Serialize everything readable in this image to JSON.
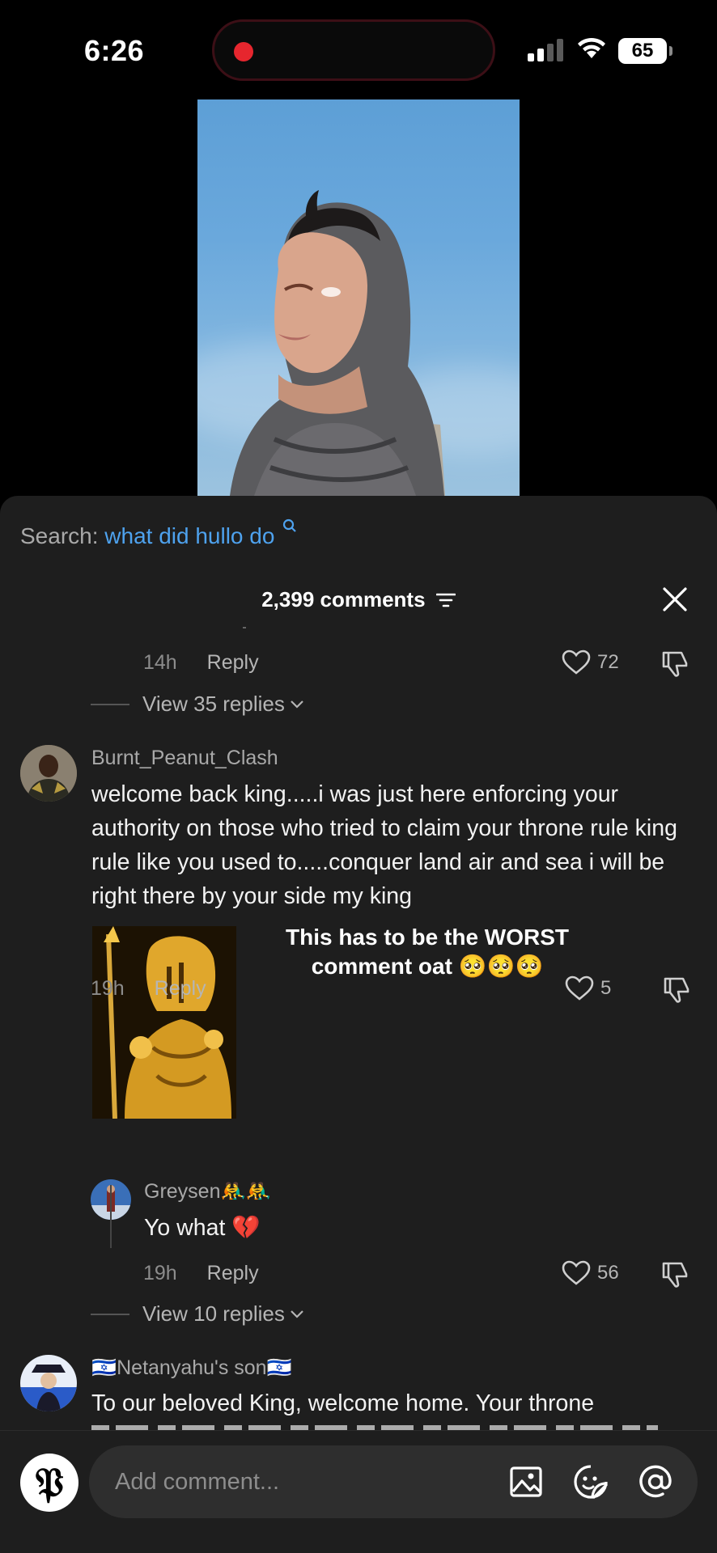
{
  "status_bar": {
    "time": "6:26",
    "battery": "65"
  },
  "search": {
    "prefix": "Search:",
    "query": "what did hullo do"
  },
  "sheet": {
    "comment_count": "2,399 comments"
  },
  "comments": [
    {
      "time": "14h",
      "reply_label": "Reply",
      "likes": "72",
      "view_replies": "View 35 replies"
    },
    {
      "username": "Burnt_Peanut_Clash",
      "text": "welcome back king.....i was just here enforcing your authority on those who tried to claim your throne rule king rule like you used to.....conquer land air and sea i will be right there by your side my king",
      "time": "19h",
      "reply_label": "Reply",
      "likes": "5",
      "view_replies": "View 10 replies",
      "reply": {
        "username": "Greysen🤼‍♂️🤼‍♂️",
        "text": "Yo what 💔",
        "time": "19h",
        "reply_label": "Reply",
        "likes": "56"
      }
    },
    {
      "username": "🇮🇱Netanyahu's son🇮🇱",
      "text": "To our beloved King, welcome home. Your throne"
    }
  ],
  "overlay_caption": {
    "line1": "This has to be the WORST",
    "line2": "comment oat 🥺🥺🥺"
  },
  "composer": {
    "avatar_letter": "𝔓",
    "placeholder": "Add comment..."
  },
  "colors": {
    "sheet_bg": "#1e1e1e",
    "link_blue": "#4ea2ee",
    "recording_red": "#e6262e"
  }
}
